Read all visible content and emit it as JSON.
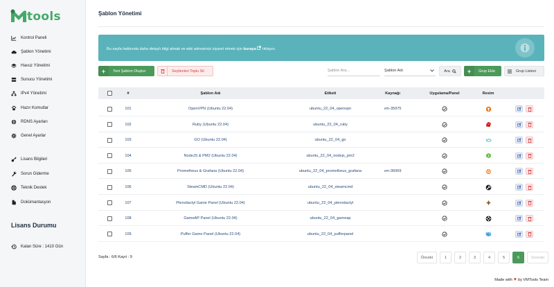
{
  "brand": {
    "word": "tools"
  },
  "sidebar": {
    "items": [
      {
        "label": "Kontrol Paneli",
        "icon": "chart-line-icon"
      },
      {
        "label": "Şablon Yönetimi",
        "icon": "cloud-icon"
      },
      {
        "label": "Havuz Yönetimi",
        "icon": "layers-icon"
      },
      {
        "label": "Sunucu Yönetimi",
        "icon": "server-icon"
      },
      {
        "label": "IPv4 Yönetimi",
        "icon": "network-icon"
      },
      {
        "label": "Hazır Komutlar",
        "icon": "paw-icon"
      },
      {
        "label": "RDNS Ayarları",
        "icon": "globe-icon"
      },
      {
        "label": "Genel Ayarlar",
        "icon": "gear-icon"
      },
      {
        "label": "Lisans Bilgileri",
        "icon": "key-icon"
      },
      {
        "label": "Sorun Giderme",
        "icon": "wrench-icon"
      },
      {
        "label": "Teknik Destek",
        "icon": "lifebuoy-icon"
      },
      {
        "label": "Dokümantasyon",
        "icon": "file-icon"
      }
    ],
    "license_title": "Lisans Durumu",
    "license_remaining": "Kalan Süre : 1410 Gün"
  },
  "page": {
    "title": "Şablon Yönetimi",
    "info_pre": "Bu sayfa hakkında daha detaylı bilgi almak ve wiki adresimizi ziyaret etmek için",
    "info_link": "buraya",
    "info_post": "tıklayın."
  },
  "toolbar": {
    "new_template": "Yeni Şablon Oluştur",
    "bulk_delete": "Seçilenleri Toplu Sil",
    "search_placeholder": "Şablon Ara...",
    "filter_selected": "Şablon Adı",
    "search_button": "Ara",
    "add_group": "Grup Ekle",
    "group_list": "Grup Listesi"
  },
  "table": {
    "headers": [
      "#",
      "Şablon Adı",
      "Etiketi",
      "Kaynağı",
      "Uygulama/Panel",
      "Resim"
    ],
    "rows": [
      {
        "id": "101",
        "name": "OpenVPN (Ubuntu 22.04)",
        "label": "ubuntu_22_04_openvpn",
        "source": "vm-35975",
        "logo": "openvpn-logo-icon"
      },
      {
        "id": "102",
        "name": "Ruby (Ubuntu 22.04)",
        "label": "ubuntu_22_04_ruby",
        "source": "",
        "logo": "ruby-logo-icon"
      },
      {
        "id": "103",
        "name": "GO (Ubuntu 22.04)",
        "label": "ubuntu_22_04_go",
        "source": "",
        "logo": "go-logo-icon"
      },
      {
        "id": "104",
        "name": "NodeJS & PM2 (Ubuntu 22.04)",
        "label": "ubuntu_22_04_nodejs_pm2",
        "source": "",
        "logo": "nodejs-logo-icon"
      },
      {
        "id": "105",
        "name": "Prometheus & Grafana (Ubuntu 22.04)",
        "label": "ubuntu_22_04_prometheus_grafana",
        "source": "vm-36069",
        "logo": "grafana-logo-icon"
      },
      {
        "id": "106",
        "name": "SteamCMD (Ubuntu 22.04)",
        "label": "ubuntu_22_04_steamcmd",
        "source": "",
        "logo": "steam-logo-icon"
      },
      {
        "id": "107",
        "name": "Pterodactyl Game Panel (Ubuntu 22.04)",
        "label": "ubuntu_22_04_pterodactyl",
        "source": "",
        "logo": "pterodactyl-logo-icon"
      },
      {
        "id": "108",
        "name": "GameAP Panel (Ubuntu 22.04)",
        "label": "ubuntu_22_04_gameap",
        "source": "",
        "logo": "gameap-logo-icon"
      },
      {
        "id": "109",
        "name": "Puffer Game Panel (Ubuntu 22.04)",
        "label": "ubuntu_22_04_pufferpanel",
        "source": "",
        "logo": "pufferpanel-logo-icon"
      }
    ]
  },
  "footer": {
    "page_info": "Sayfa : 6/6 Kayıt : 9",
    "pager": [
      "Önceki",
      "1",
      "2",
      "3",
      "4",
      "5",
      "6",
      "Sonraki"
    ],
    "active_page": "6",
    "made_pre": "Made with",
    "made_post": "by VMTools Team"
  },
  "colors": {
    "brand_green": "#46a86a",
    "button_green": "#4c9a5b",
    "info_teal": "#5ab3bb",
    "danger": "#d23b3b"
  }
}
